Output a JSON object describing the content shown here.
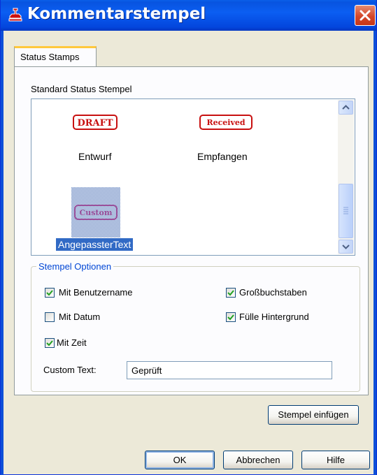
{
  "window": {
    "title": "Kommentarstempel",
    "colors": {
      "titlebar": "#0b5ef2",
      "close": "#d4472a",
      "frame": "#0d4fd8",
      "selection": "#316ac5"
    }
  },
  "tabs": [
    {
      "label": "Status Stamps",
      "active": true
    }
  ],
  "stamps_section": {
    "label": "Standard Status Stempel",
    "stamps": [
      {
        "graphic_text": "DRAFT",
        "label": "Entwurf",
        "selected": false
      },
      {
        "graphic_text": "Received",
        "label": "Empfangen",
        "selected": false
      },
      {
        "graphic_text": "Custom",
        "label": "AngepassterText",
        "selected": true
      }
    ]
  },
  "options": {
    "legend": "Stempel Optionen",
    "checkboxes": [
      {
        "label": "Mit Benutzername",
        "checked": true
      },
      {
        "label": "Großbuchstaben",
        "checked": true
      },
      {
        "label": "Mit Datum",
        "checked": false
      },
      {
        "label": "Fülle Hintergrund",
        "checked": true
      },
      {
        "label": "Mit Zeit",
        "checked": true
      }
    ],
    "custom_text_label": "Custom Text:",
    "custom_text_value": "Geprüft"
  },
  "buttons": {
    "insert_stamp": "Stempel einfügen",
    "ok": "OK",
    "cancel": "Abbrechen",
    "help": "Hilfe"
  }
}
